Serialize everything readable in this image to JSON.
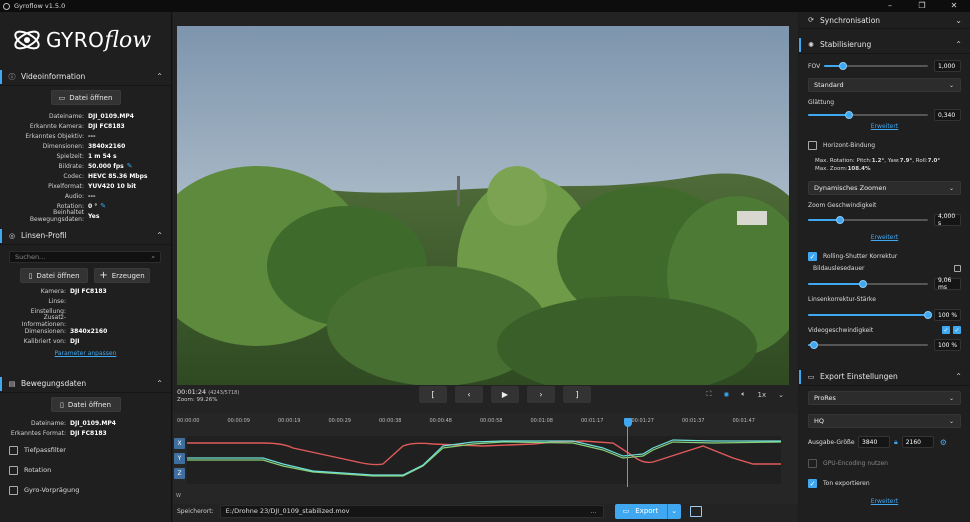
{
  "window": {
    "title": "Gyroflow v1.5.0"
  },
  "logo": {
    "word": "GYRO",
    "script": "flow"
  },
  "video_info": {
    "title": "Videoinformation",
    "open_button": "Datei öffnen",
    "rows": [
      {
        "k": "Dateiname:",
        "v": "DJI_0109.MP4"
      },
      {
        "k": "Erkannte Kamera:",
        "v": "DJI FC8183"
      },
      {
        "k": "Erkanntes Objektiv:",
        "v": "---"
      },
      {
        "k": "Dimensionen:",
        "v": "3840x2160"
      },
      {
        "k": "Spielzeit:",
        "v": "1 m 54 s"
      },
      {
        "k": "Bildrate:",
        "v": "50.000 fps"
      },
      {
        "k": "Codec:",
        "v": "HEVC 85.36 Mbps"
      },
      {
        "k": "Pixelformat:",
        "v": "YUV420 10 bit"
      },
      {
        "k": "Audio:",
        "v": "---"
      },
      {
        "k": "Rotation:",
        "v": "0 °"
      },
      {
        "k": "Beinhaltet Bewegungsdaten:",
        "v": "Yes"
      }
    ]
  },
  "lens": {
    "title": "Linsen-Profil",
    "search_placeholder": "Suchen...",
    "open_button": "Datei öffnen",
    "create_button": "Erzeugen",
    "rows": [
      {
        "k": "Kamera:",
        "v": "DJI FC8183"
      },
      {
        "k": "Linse:",
        "v": ""
      },
      {
        "k": "Einstellung:",
        "v": ""
      },
      {
        "k": "Zusatz-Informationen:",
        "v": ""
      },
      {
        "k": "Dimensionen:",
        "v": "3840x2160"
      },
      {
        "k": "Kalibriert von:",
        "v": "DJI"
      }
    ],
    "adjust_link": "Parameter anpassen"
  },
  "motion": {
    "title": "Bewegungsdaten",
    "open_button": "Datei öffnen",
    "rows": [
      {
        "k": "Dateiname:",
        "v": "DJI_0109.MP4"
      },
      {
        "k": "Erkanntes Format:",
        "v": "DJI FC8183"
      }
    ],
    "checks": [
      "Tiefpassfilter",
      "Rotation",
      "Gyro-Vorprägung"
    ]
  },
  "player": {
    "time": "00:01:24",
    "frames": "(4243/5718)",
    "zoom": "Zoom: 99.26%",
    "speed": "1x",
    "controls": [
      "[",
      "‹",
      "▶",
      "›",
      "]"
    ]
  },
  "timeline": {
    "ticks": [
      "00:00:00",
      "00:00:09",
      "00:00:19",
      "00:00:29",
      "00:00:38",
      "00:00:48",
      "00:00:58",
      "00:01:08",
      "00:01:17",
      "00:01:27",
      "00:01:37",
      "00:01:47"
    ],
    "axes": [
      "X",
      "Y",
      "Z"
    ],
    "w_label": "W",
    "playhead_fraction": 0.742
  },
  "export_bar": {
    "label": "Speicherort:",
    "path": "E:/Drohne 23/DJI_0109_stabilized.mov",
    "dots": "...",
    "button": "Export"
  },
  "sync": {
    "title": "Synchronisation"
  },
  "stab": {
    "title": "Stabilisierung",
    "fov_label": "FOV",
    "fov_value": "1,000",
    "fov_fraction": 0.18,
    "method": "Standard",
    "smooth_label": "Glättung",
    "smooth_value": "0,340",
    "smooth_fraction": 0.34,
    "advanced_link": "Erweitert",
    "horizon_label": "Horizont-Bindung",
    "maxrot_prefix": "Max. Rotation: Pitch: ",
    "maxrot_pitch": "1.2°",
    "maxrot_yaw_label": ", Yaw: ",
    "maxrot_yaw": "7.9°",
    "maxrot_roll_label": ", Roll: ",
    "maxrot_roll": "7.0°",
    "maxzoom_prefix": "Max. Zoom: ",
    "maxzoom": "108.4%",
    "dyn_zoom": "Dynamisches Zoomen",
    "zoom_speed_label": "Zoom Geschwindigkeit",
    "zoom_speed_value": "4,000 s",
    "zoom_speed_fraction": 0.27,
    "advanced_link2": "Erweitert",
    "rs_label": "Rolling-Shutter Korrektur",
    "frame_readout_label": "Bildauslesedauer",
    "readout_value": "9,06 ms",
    "readout_fraction": 0.46,
    "lens_strength_label": "Linsenkorrektur-Stärke",
    "lens_strength_value": "100 %",
    "lens_strength_fraction": 1.0,
    "video_speed_label": "Videogeschwindigkeit",
    "video_speed_value": "100 %",
    "video_speed_fraction": 0.05
  },
  "export": {
    "title": "Export Einstellungen",
    "codec": "ProRes",
    "profile": "HQ",
    "size_label": "Ausgabe-Größe",
    "width": "3840",
    "height": "2160",
    "gpu_label": "GPU-Encoding nutzen",
    "audio_label": "Ton exportieren",
    "advanced_link": "Erweitert"
  },
  "colors": {
    "accent": "#3fa8f0",
    "curve_red": "#e05a5a",
    "curve_cyan": "#6fe0d8",
    "curve_green": "#8ad07a"
  }
}
